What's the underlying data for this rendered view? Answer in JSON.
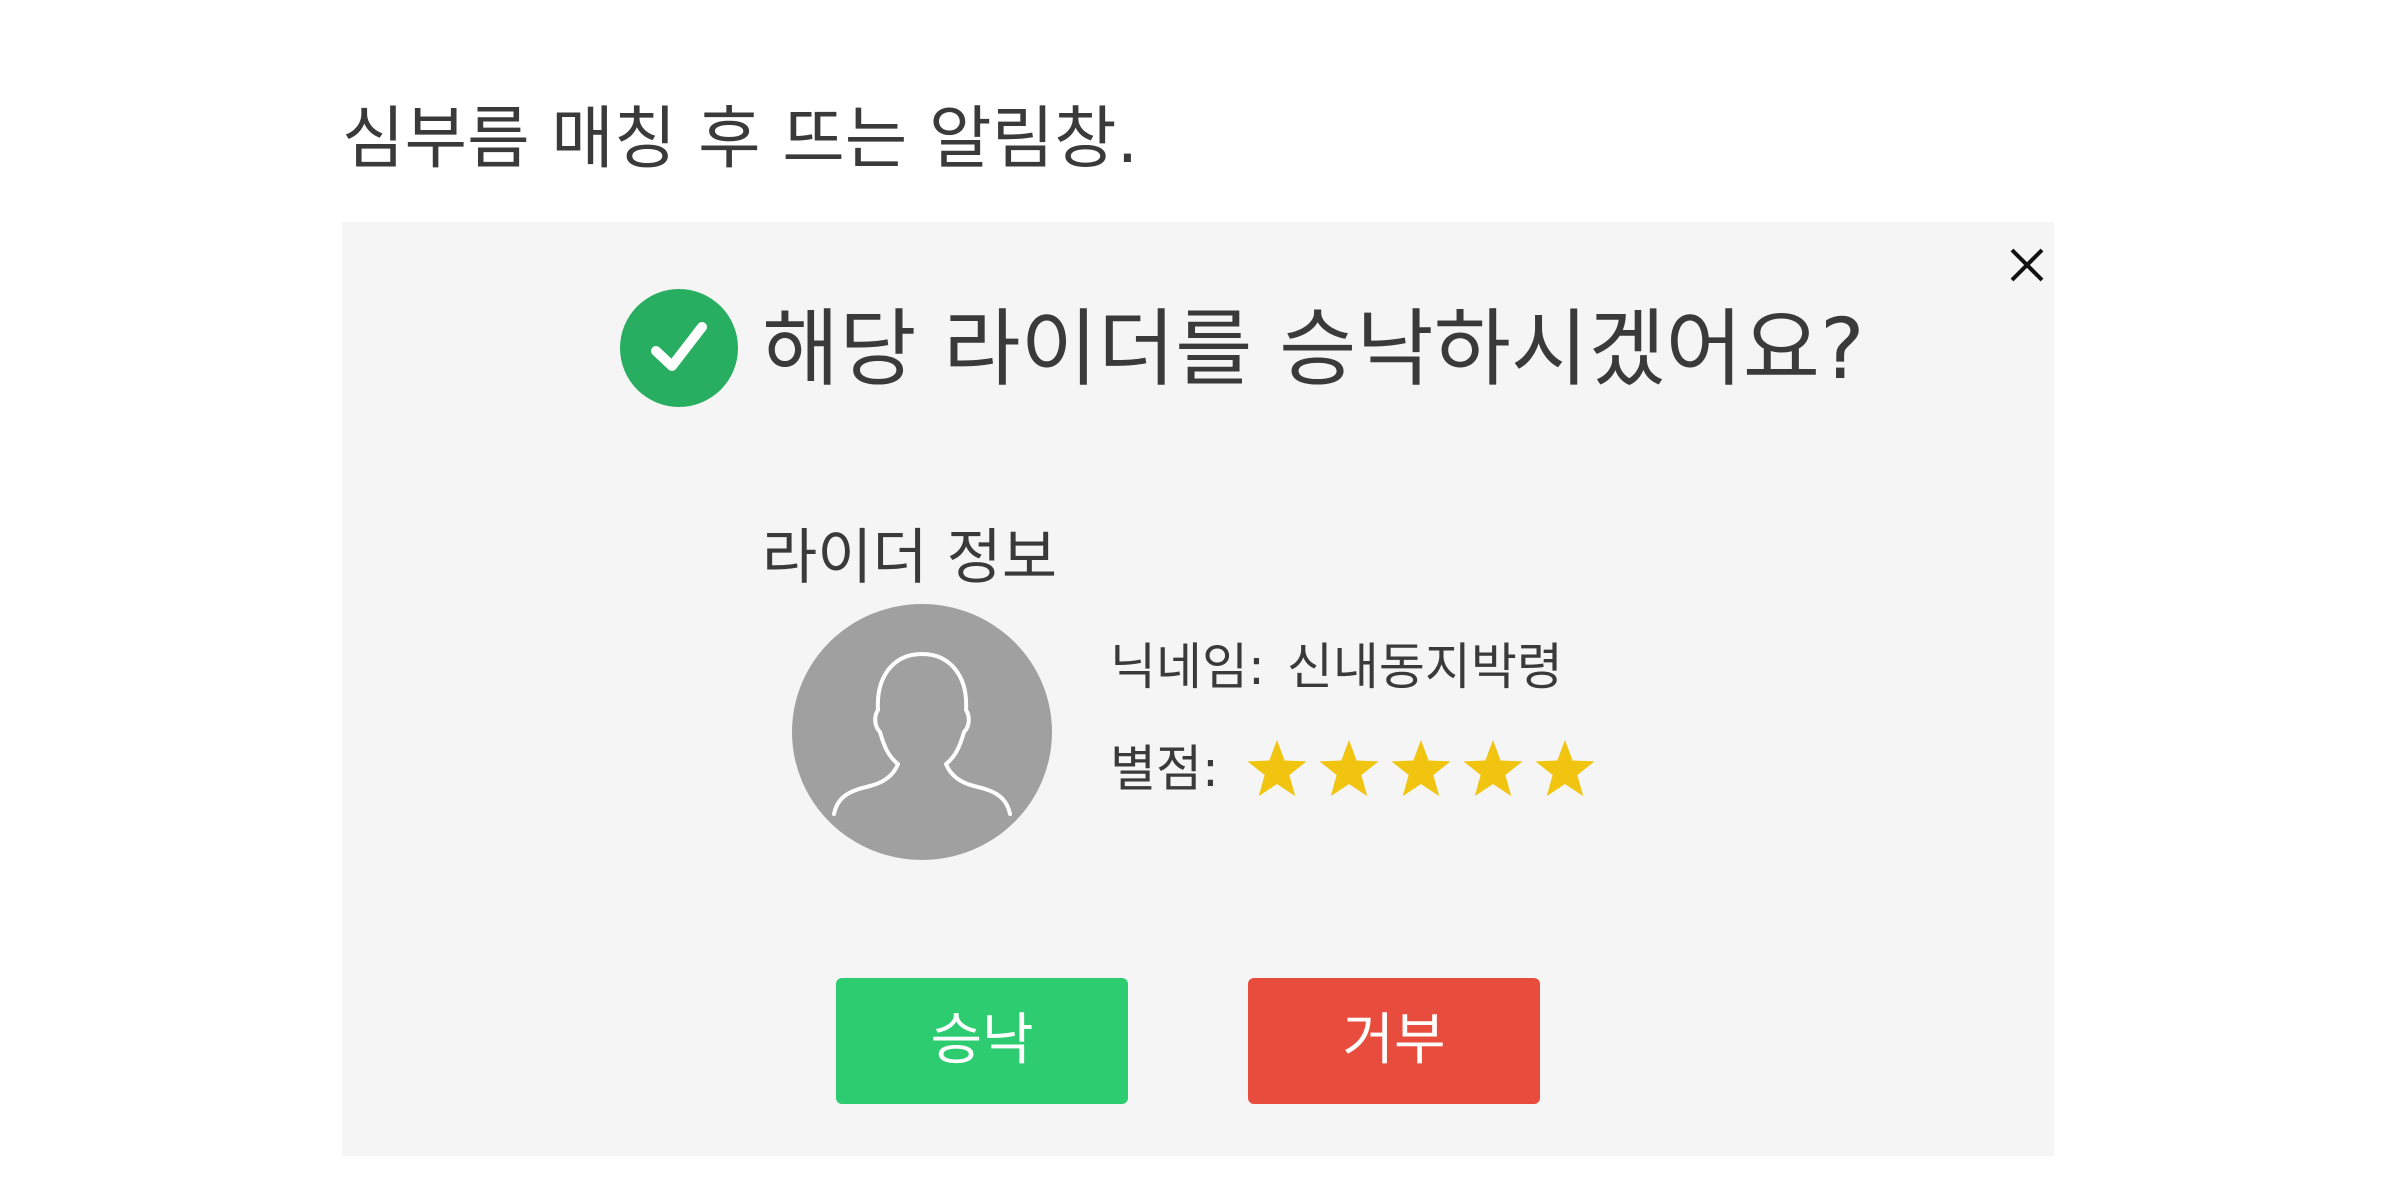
{
  "page": {
    "heading": "심부름 매칭 후 뜨는 알림창."
  },
  "dialog": {
    "title": "해당 라이더를 승낙하시겠어요?",
    "close_icon": "close-icon",
    "check_icon": "check-circle-icon",
    "section_label": "라이더 정보",
    "avatar_icon": "user-silhouette-icon",
    "nickname_label": "닉네임:",
    "nickname_value": "신내동지박령",
    "rating_label": "별점:",
    "rating": {
      "value": 5,
      "max": 5
    },
    "accept_label": "승낙",
    "reject_label": "거부"
  },
  "colors": {
    "check_badge": "#27ae60",
    "star": "#f1c40f",
    "avatar": "#a0a0a0",
    "accept": "#2ecc71",
    "reject": "#e74c3c",
    "dialog_bg": "#f5f5f5"
  }
}
